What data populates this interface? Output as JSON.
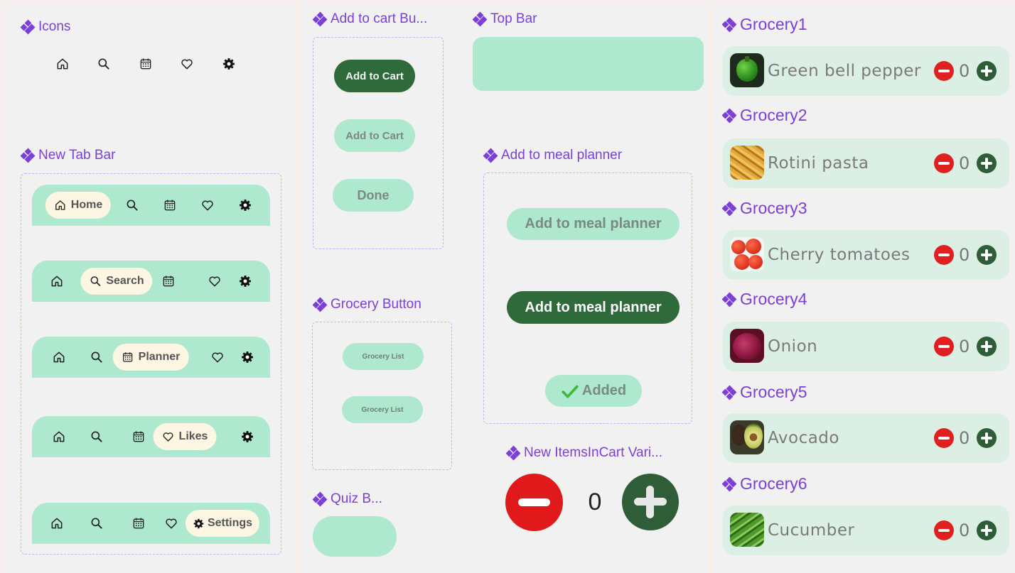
{
  "sections": {
    "icons": "Icons",
    "tab_bar": "New Tab Bar",
    "add_to_cart": "Add to cart Bu...",
    "grocery_button": "Grocery Button",
    "quiz": "Quiz B...",
    "top_bar": "Top Bar",
    "meal_planner": "Add to meal planner",
    "items_in_cart": "New ItemsInCart Vari..."
  },
  "tabs": {
    "home": "Home",
    "search": "Search",
    "planner": "Planner",
    "likes": "Likes",
    "settings": "Settings"
  },
  "cart_buttons": {
    "primary": "Add to Cart",
    "secondary": "Add to Cart",
    "done": "Done"
  },
  "grocery_buttons": [
    "Grocery List",
    "Grocery List"
  ],
  "meal_buttons": {
    "light": "Add to meal planner",
    "dark": "Add to meal planner",
    "added": "Added"
  },
  "cart_counter": {
    "value": "0"
  },
  "groceries": [
    {
      "title": "Grocery1",
      "name": "Green bell pepper",
      "qty": "0"
    },
    {
      "title": "Grocery2",
      "name": "Rotini pasta",
      "qty": "0"
    },
    {
      "title": "Grocery3",
      "name": "Cherry tomatoes",
      "qty": "0"
    },
    {
      "title": "Grocery4",
      "name": "Onion",
      "qty": "0"
    },
    {
      "title": "Grocery5",
      "name": "Avocado",
      "qty": "0"
    },
    {
      "title": "Grocery6",
      "name": "Cucumber",
      "qty": "0"
    }
  ],
  "colors": {
    "accent": "#7c3fd6",
    "mint": "#aee8cf",
    "dark_green": "#2f6a3b",
    "red": "#e02020",
    "panel": "#f1f1f1"
  }
}
